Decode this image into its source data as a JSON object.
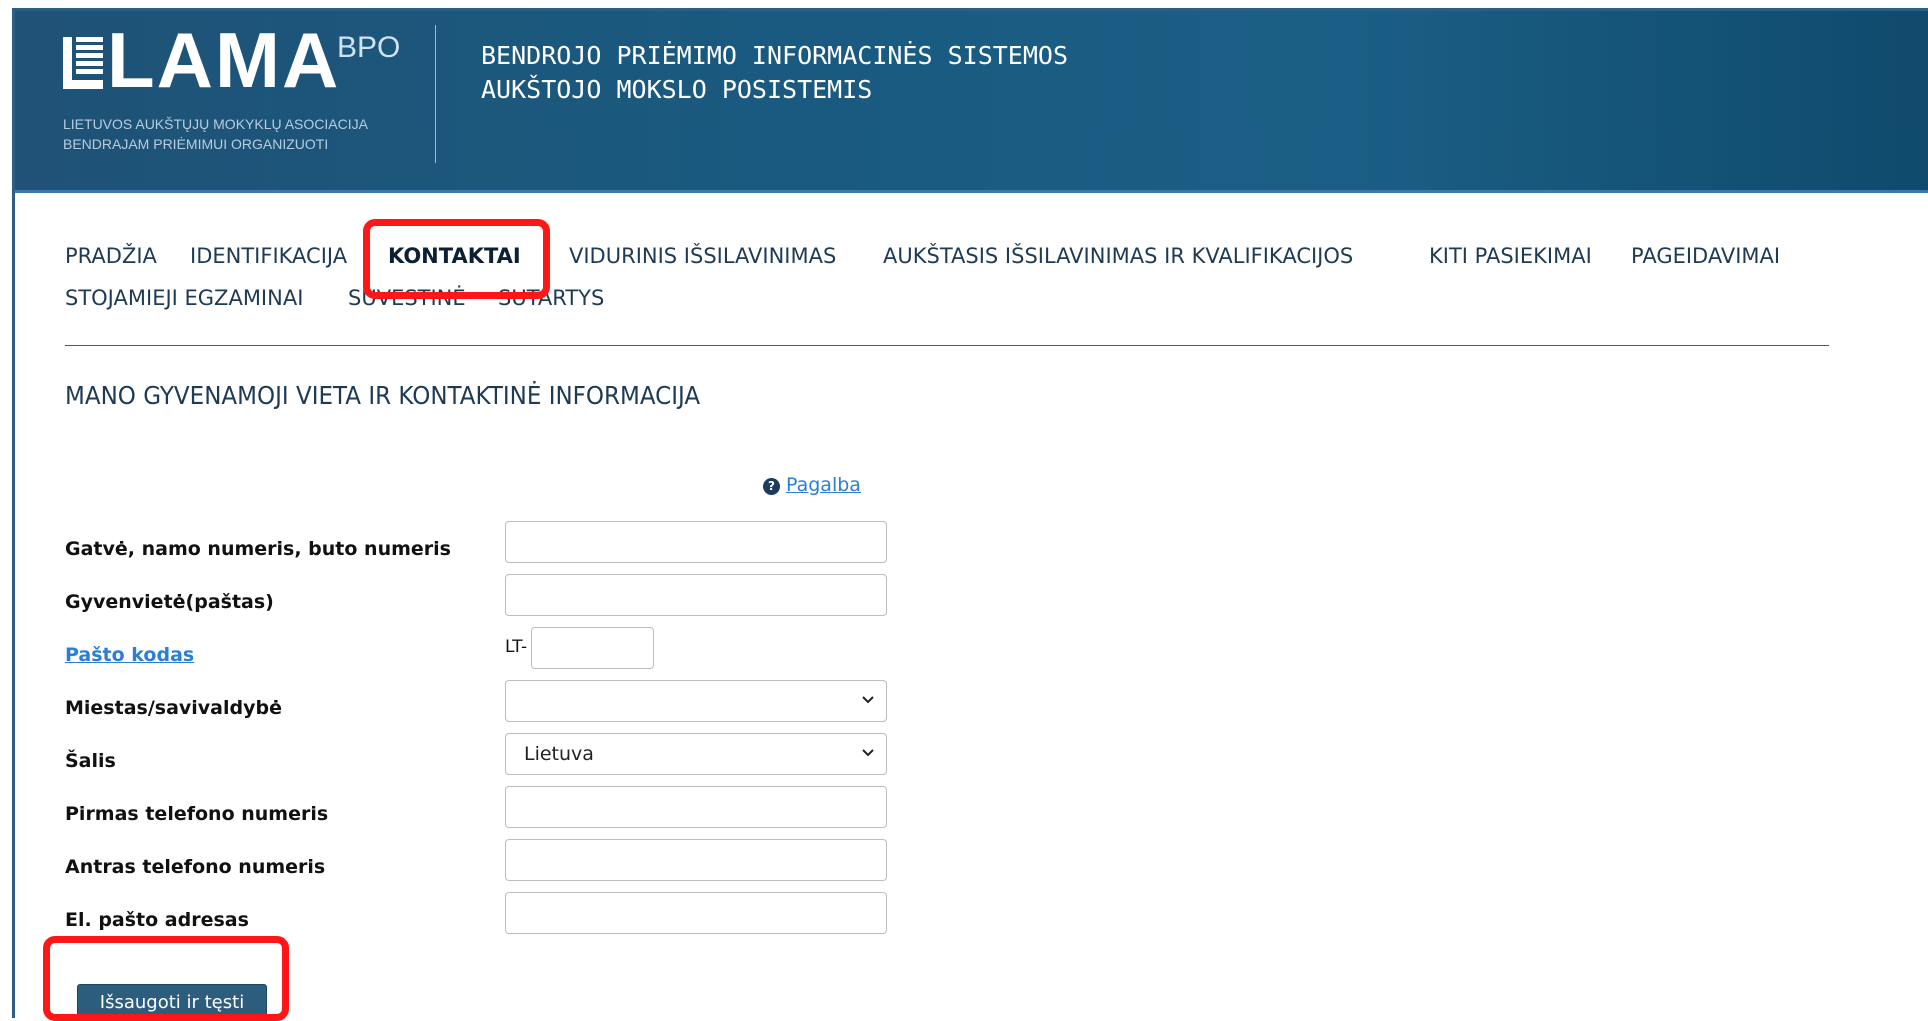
{
  "header": {
    "logo_text": "LAMA",
    "logo_superscript": "BPO",
    "logo_subtitle_line1": "LIETUVOS AUKŠTŲJŲ MOKYKLŲ ASOCIACIJA",
    "logo_subtitle_line2": "BENDRAJAM PRIĖMIMUI ORGANIZUOTI",
    "title_line1": "BENDROJO PRIĖMIMO INFORMACINĖS SISTEMOS",
    "title_line2": "AUKŠTOJO MOKSLO POSISTEMIS"
  },
  "nav": {
    "items": [
      {
        "label": "PRADŽIA"
      },
      {
        "label": "IDENTIFIKACIJA"
      },
      {
        "label": "KONTAKTAI",
        "active": true
      },
      {
        "label": "VIDURINIS IŠSILAVINIMAS"
      },
      {
        "label": "AUKŠTASIS IŠSILAVINIMAS IR KVALIFIKACIJOS"
      },
      {
        "label": "KITI PASIEKIMAI"
      },
      {
        "label": "PAGEIDAVIMAI"
      },
      {
        "label": "STOJAMIEJI EGZAMINAI"
      },
      {
        "label": "SUVESTINĖ"
      },
      {
        "label": "SUTARTYS"
      }
    ]
  },
  "page_title": "MANO GYVENAMOJI VIETA IR KONTAKTINĖ INFORMACIJA",
  "help": {
    "label": "Pagalba"
  },
  "form": {
    "street_label": "Gatvė, namo numeris, buto numeris",
    "street_value": "",
    "settlement_label": "Gyvenvietė(paštas)",
    "settlement_value": "",
    "postal_label": "Pašto kodas",
    "postal_prefix": "LT-",
    "postal_value": "",
    "city_label": "Miestas/savivaldybė",
    "city_value": "",
    "country_label": "Šalis",
    "country_value": "Lietuva",
    "phone1_label": "Pirmas telefono numeris",
    "phone1_value": "",
    "phone2_label": "Antras telefono numeris",
    "phone2_value": "",
    "email_label": "El. pašto adresas",
    "email_value": ""
  },
  "buttons": {
    "save_label": "Išsaugoti ir tęsti"
  },
  "colors": {
    "header": "#1b5e85",
    "button": "#2d5d7c",
    "highlight": "#ff1717",
    "link": "#2a7fd4"
  }
}
